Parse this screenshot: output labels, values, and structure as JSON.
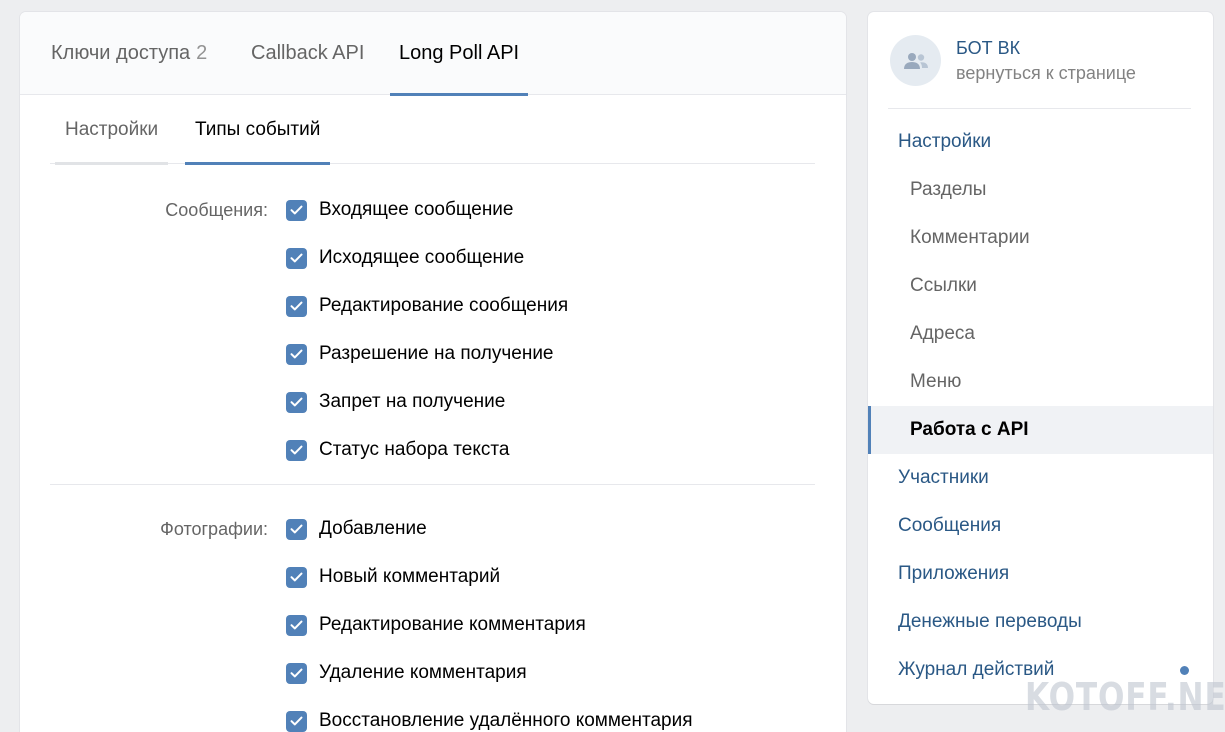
{
  "main": {
    "tabs": [
      {
        "label": "Ключи доступа",
        "count": "2"
      },
      {
        "label": "Callback API"
      },
      {
        "label": "Long Poll API"
      }
    ],
    "subtabs": [
      {
        "label": "Настройки"
      },
      {
        "label": "Типы событий"
      }
    ],
    "sections": [
      {
        "label": "Сообщения:",
        "options": [
          "Входящее сообщение",
          "Исходящее сообщение",
          "Редактирование сообщения",
          "Разрешение на получение",
          "Запрет на получение",
          "Статус набора текста"
        ]
      },
      {
        "label": "Фотографии:",
        "options": [
          "Добавление",
          "Новый комментарий",
          "Редактирование комментария",
          "Удаление комментария",
          "Восстановление удалённого комментария"
        ]
      }
    ]
  },
  "sidebar": {
    "title": "БОТ ВК",
    "subtitle": "вернуться к странице",
    "items": [
      {
        "label": "Настройки"
      },
      {
        "label": "Разделы"
      },
      {
        "label": "Комментарии"
      },
      {
        "label": "Ссылки"
      },
      {
        "label": "Адреса"
      },
      {
        "label": "Меню"
      },
      {
        "label": "Работа с API"
      },
      {
        "label": "Участники"
      },
      {
        "label": "Сообщения"
      },
      {
        "label": "Приложения"
      },
      {
        "label": "Денежные переводы"
      },
      {
        "label": "Журнал действий"
      }
    ]
  },
  "watermark": "KOTOFF.NET",
  "colors": {
    "accent": "#5181b8",
    "link": "#2a5885",
    "muted": "#656565"
  }
}
